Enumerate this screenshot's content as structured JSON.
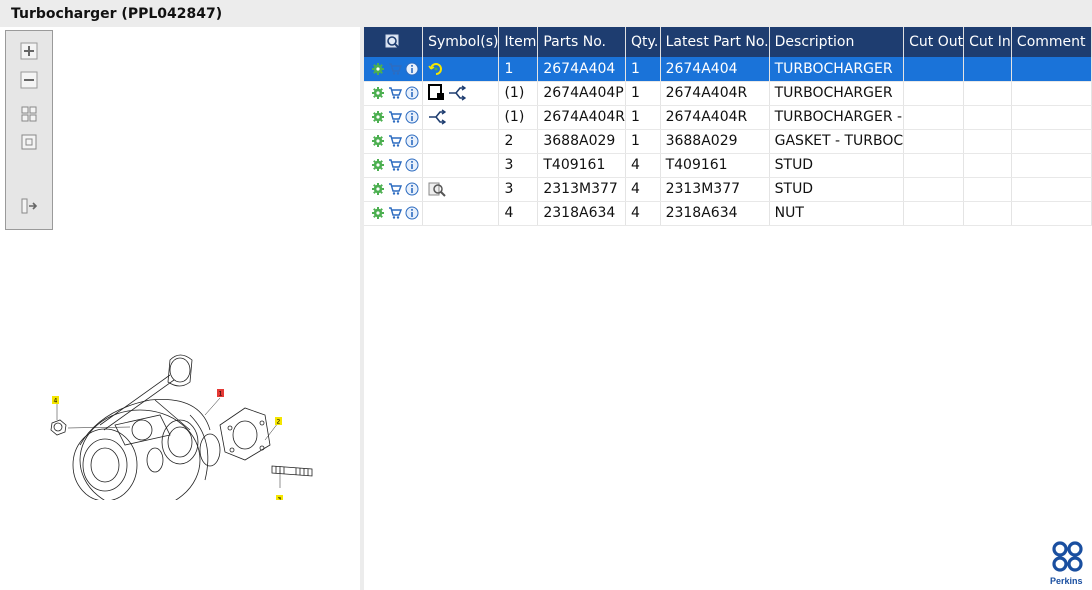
{
  "window": {
    "title": "Turbocharger (PPL042847)"
  },
  "toolbar": {
    "buttons": [
      {
        "name": "zoom-in-button",
        "icon": "zoom-in-icon"
      },
      {
        "name": "zoom-out-button",
        "icon": "zoom-out-icon"
      },
      {
        "name": "fit-page-button",
        "icon": "fit-page-icon"
      },
      {
        "name": "actual-size-button",
        "icon": "actual-size-icon"
      },
      {
        "name": "toggle-panel-button",
        "icon": "panel-arrow-icon"
      }
    ]
  },
  "diagram": {
    "callouts": [
      "4",
      "1",
      "2",
      "3"
    ],
    "callout_color": "#f5e600",
    "highlight_color": "#e53935"
  },
  "table": {
    "columns": [
      "Symbol(s)",
      "Item",
      "Parts No.",
      "Qty.",
      "Latest Part No.",
      "Description",
      "Cut Out",
      "Cut In",
      "Comment"
    ],
    "header_icon": "search-parts-icon",
    "rows": [
      {
        "symbols": [
          "rotate-icon"
        ],
        "item": "1",
        "parts_no": "2674A404",
        "qty": "1",
        "latest": "2674A404",
        "description": "TURBOCHARGER",
        "cut_out": "",
        "cut_in": "",
        "comment": "",
        "selected": true
      },
      {
        "symbols": [
          "kit-icon",
          "alternate-icon"
        ],
        "item": "(1)",
        "parts_no": "2674A404P",
        "qty": "1",
        "latest": "2674A404R",
        "description": "TURBOCHARGER",
        "cut_out": "",
        "cut_in": "",
        "comment": "",
        "selected": false
      },
      {
        "symbols": [
          "alternate-icon"
        ],
        "item": "(1)",
        "parts_no": "2674A404R",
        "qty": "1",
        "latest": "2674A404R",
        "description": "TURBOCHARGER -",
        "cut_out": "",
        "cut_in": "",
        "comment": "",
        "selected": false
      },
      {
        "symbols": [],
        "item": "2",
        "parts_no": "3688A029",
        "qty": "1",
        "latest": "3688A029",
        "description": "GASKET - TURBOC",
        "cut_out": "",
        "cut_in": "",
        "comment": "",
        "selected": false
      },
      {
        "symbols": [],
        "item": "3",
        "parts_no": "T409161",
        "qty": "4",
        "latest": "T409161",
        "description": "STUD",
        "cut_out": "",
        "cut_in": "",
        "comment": "",
        "selected": false
      },
      {
        "symbols": [
          "inspect-icon"
        ],
        "item": "3",
        "parts_no": "2313M377",
        "qty": "4",
        "latest": "2313M377",
        "description": "STUD",
        "cut_out": "",
        "cut_in": "",
        "comment": "",
        "selected": false
      },
      {
        "symbols": [],
        "item": "4",
        "parts_no": "2318A634",
        "qty": "4",
        "latest": "2318A634",
        "description": "NUT",
        "cut_out": "",
        "cut_in": "",
        "comment": "",
        "selected": false
      }
    ]
  },
  "brand": {
    "name": "Perkins",
    "color": "#1a4fa0"
  },
  "colors": {
    "header": "#1e3d70",
    "selected": "#1a73d9",
    "gear": "#4caf50",
    "cart": "#2d6cc0",
    "info": "#2d6cc0"
  }
}
